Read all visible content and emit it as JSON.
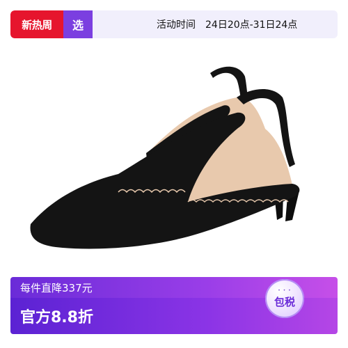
{
  "banner": {
    "promo_badge": "新热周",
    "select_badge": "选",
    "event_label": "活动时间",
    "event_range": "24日20点-31日24点"
  },
  "product": {
    "image_icon": "black-suede-slingback-pumps",
    "colors": {
      "suede": "#141414",
      "lining": "#e8c9ad",
      "heel": "#0d0d0d"
    }
  },
  "price_banner": {
    "promo_text": "每件直降337元",
    "price_text": "官方8.8折",
    "tax_badge": "包税",
    "colors": {
      "primary": "#6a2bd8",
      "accent": "#c64fe8",
      "promo_red": "#e6152d"
    }
  }
}
